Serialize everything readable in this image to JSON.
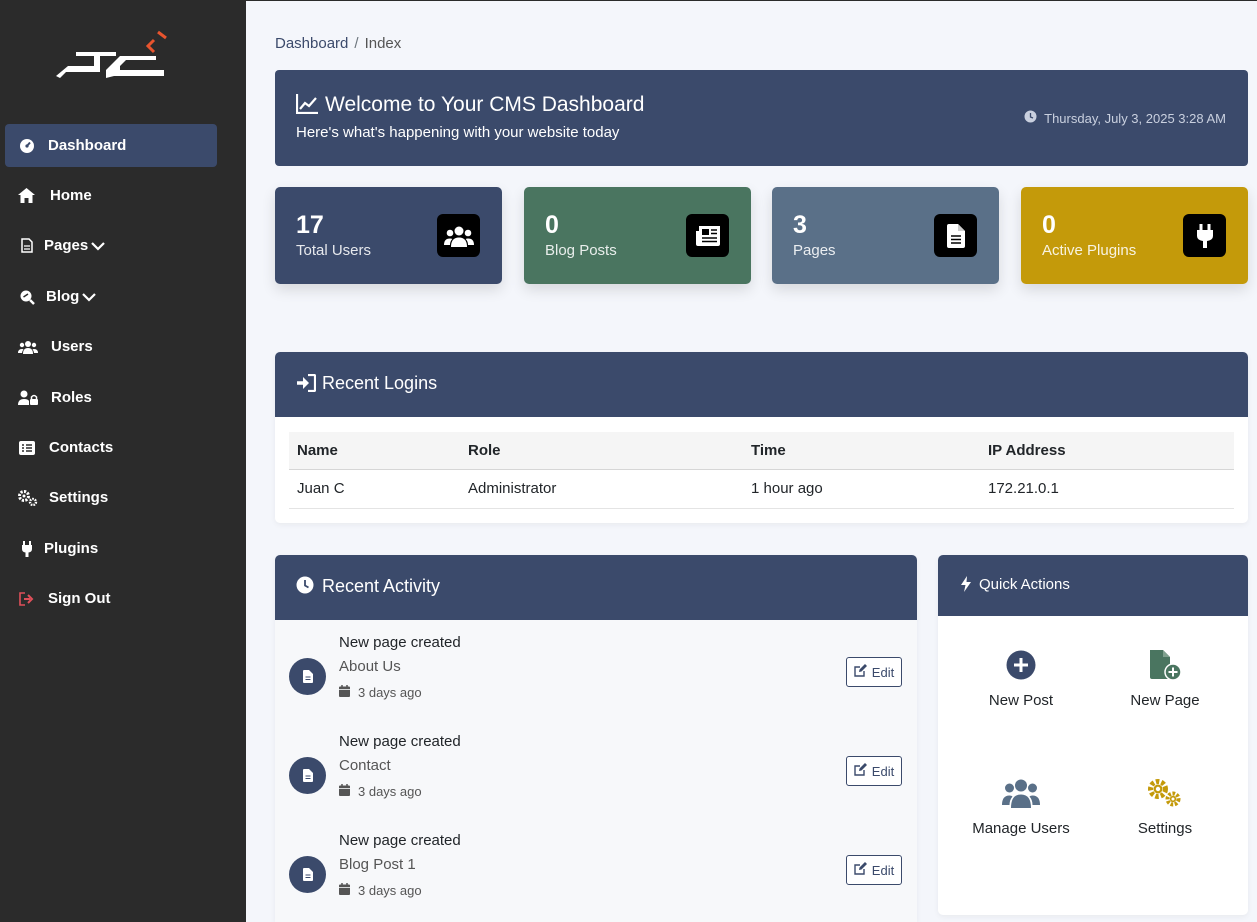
{
  "sidebar": {
    "items": [
      {
        "label": "Dashboard"
      },
      {
        "label": "Home"
      },
      {
        "label": "Pages"
      },
      {
        "label": "Blog"
      },
      {
        "label": "Users"
      },
      {
        "label": "Roles"
      },
      {
        "label": "Contacts"
      },
      {
        "label": "Settings"
      },
      {
        "label": "Plugins"
      },
      {
        "label": "Sign Out"
      }
    ]
  },
  "breadcrumb": {
    "root": "Dashboard",
    "separator": "/",
    "current": "Index"
  },
  "welcome": {
    "title": "Welcome to Your CMS Dashboard",
    "subtitle": "Here's what's happening with your website today",
    "date": "Thursday, July 3, 2025 3:28 AM"
  },
  "stats": [
    {
      "value": "17",
      "label": "Total Users",
      "color": "#3b4a6b"
    },
    {
      "value": "0",
      "label": "Blog Posts",
      "color": "#4a7560"
    },
    {
      "value": "3",
      "label": "Pages",
      "color": "#5a7088"
    },
    {
      "value": "0",
      "label": "Active Plugins",
      "color": "#c49a0a"
    }
  ],
  "recent_logins": {
    "title": "Recent Logins",
    "columns": [
      "Name",
      "Role",
      "Time",
      "IP Address"
    ],
    "rows": [
      [
        "Juan C",
        "Administrator",
        "1 hour ago",
        "172.21.0.1"
      ]
    ]
  },
  "recent_activity": {
    "title": "Recent Activity",
    "items": [
      {
        "action": "New page created",
        "target": "About Us",
        "time": "3 days ago",
        "button": "Edit"
      },
      {
        "action": "New page created",
        "target": "Contact",
        "time": "3 days ago",
        "button": "Edit"
      },
      {
        "action": "New page created",
        "target": "Blog Post 1",
        "time": "3 days ago",
        "button": "Edit"
      }
    ]
  },
  "quick_actions": {
    "title": "Quick Actions",
    "items": [
      {
        "label": "New Post",
        "icon": "plus-circle-icon"
      },
      {
        "label": "New Page",
        "icon": "file-plus-icon"
      },
      {
        "label": "Manage Users",
        "icon": "users-icon"
      },
      {
        "label": "Settings",
        "icon": "gears-icon"
      }
    ]
  },
  "colors": {
    "primary": "#3b4a6b",
    "sidebar": "#2b2b2b",
    "success": "#4a7560",
    "info": "#5a7088",
    "warning": "#c49a0a",
    "signout": "#e0505a"
  }
}
